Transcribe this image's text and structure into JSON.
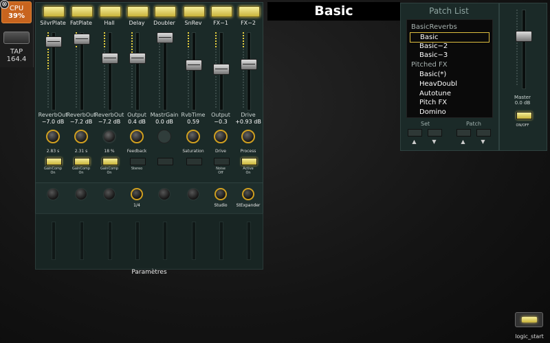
{
  "cpu": {
    "label": "CPU",
    "value": "39%"
  },
  "tap": {
    "label": "TAP",
    "value": "164.4"
  },
  "channels": [
    {
      "name": "SilvrPlate",
      "param": "ReverbOut",
      "value": "−7.0 dB",
      "knob_label": "2.83 s",
      "button_label": "GainComp",
      "button_state": "On",
      "button_on": true
    },
    {
      "name": "FatPlate",
      "param": "ReverbOut",
      "value": "−7.2 dB",
      "knob_label": "2.31 s",
      "button_label": "GainComp",
      "button_state": "On",
      "button_on": true
    },
    {
      "name": "Hall",
      "param": "ReverbOut",
      "value": "−7.2 dB",
      "knob_label": "18 %",
      "button_label": "GainComp",
      "button_state": "On",
      "button_on": true
    },
    {
      "name": "Delay",
      "param": "Output",
      "value": "0.4 dB",
      "knob_label": "Feedback",
      "button_label": "Stereo",
      "button_state": "",
      "button_on": false
    },
    {
      "name": "Doubler",
      "param": "MastrGain",
      "value": "0.0 dB",
      "knob_label": "",
      "button_label": "",
      "button_state": "",
      "button_on": false
    },
    {
      "name": "SnRev",
      "param": "RvbTime",
      "value": "0.59",
      "knob_label": "Saturation",
      "button_label": "",
      "button_state": "",
      "button_on": false
    },
    {
      "name": "FX−1",
      "param": "Output",
      "value": "−0.3",
      "knob_label": "Drive",
      "button_label": "Noise",
      "button_state": "Off",
      "button_on": false
    },
    {
      "name": "FX−2",
      "param": "Drive",
      "value": "+0.93 dB",
      "knob_label": "Process",
      "button_label": "Active",
      "button_state": "On",
      "button_on": true
    }
  ],
  "row2": [
    "",
    "",
    "",
    "1/4",
    "",
    "",
    "Studio",
    "StExpander"
  ],
  "parameters_label": "Paramètres",
  "title": "Basic",
  "patch_list": {
    "title": "Patch List",
    "items": [
      {
        "text": "BasicReverbs",
        "kind": "group"
      },
      {
        "text": "Basic",
        "kind": "selected"
      },
      {
        "text": "Basic−2",
        "kind": "sub"
      },
      {
        "text": "Basic−3",
        "kind": "sub"
      },
      {
        "text": "Pitched FX",
        "kind": "group"
      },
      {
        "text": "Basic(*)",
        "kind": "sub"
      },
      {
        "text": "HeavDoubl",
        "kind": "sub"
      },
      {
        "text": "Autotune",
        "kind": "sub"
      },
      {
        "text": "Pitch FX",
        "kind": "sub"
      },
      {
        "text": "Domino",
        "kind": "sub"
      }
    ],
    "set_label": "Set",
    "patch_label": "Patch",
    "up_arrow": "▲",
    "down_arrow": "▼"
  },
  "master": {
    "label": "Master",
    "value": "0.0 dB",
    "onoff_label": "ON/OFF"
  },
  "logic_start_label": "logic_start",
  "close_icon": "⊗",
  "colors": {
    "led": "#e8d040",
    "panel": "#1b2a28",
    "cpu": "#c8641e"
  }
}
